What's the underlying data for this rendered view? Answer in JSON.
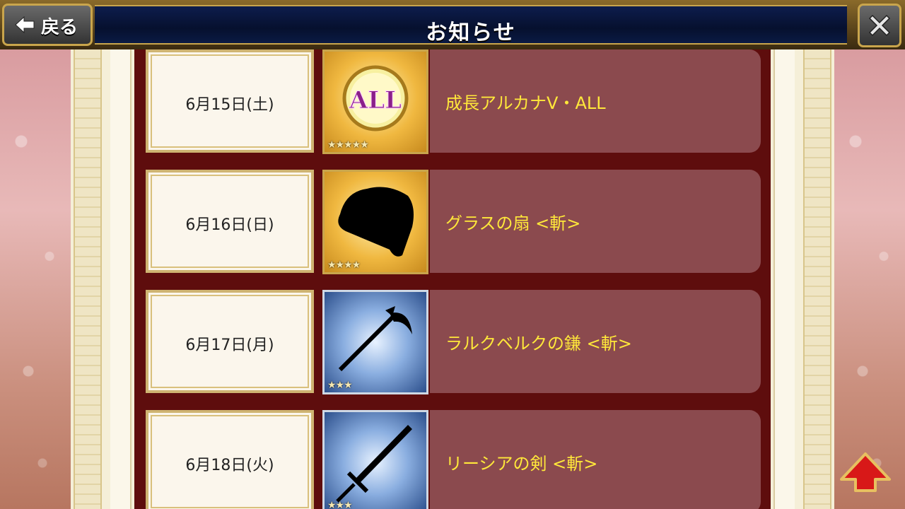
{
  "header": {
    "title": "お知らせ",
    "back_label": "戻る"
  },
  "rows": [
    {
      "date": "6月15日(土)",
      "name": "成長アルカナV・ALL",
      "icon_badge": "ALL",
      "stars": "★★★★★"
    },
    {
      "date": "6月16日(日)",
      "name": "グラスの扇 <斬>",
      "stars": "★★★★"
    },
    {
      "date": "6月17日(月)",
      "name": "ラルクベルクの鎌 <斬>",
      "stars": "★★★"
    },
    {
      "date": "6月18日(火)",
      "name": "リーシアの剣 <斬>",
      "stars": "★★★"
    }
  ],
  "icons": {
    "back": "left-arrow-icon",
    "close": "close-icon",
    "scroll_up": "up-arrow-icon"
  }
}
